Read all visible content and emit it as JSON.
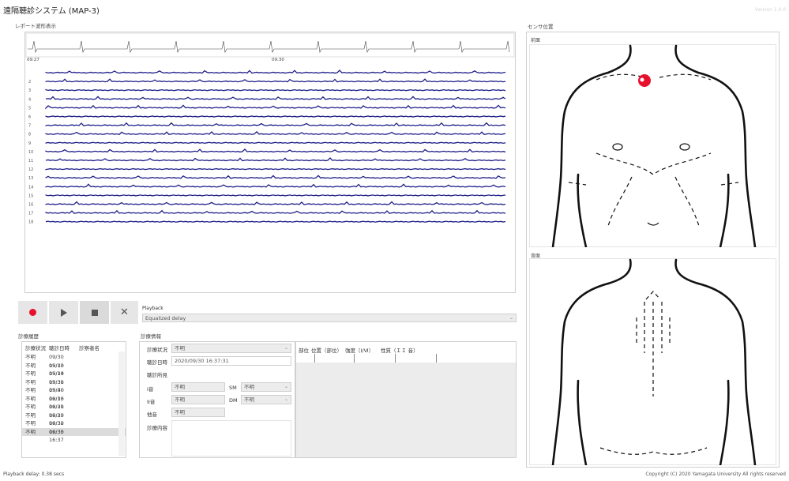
{
  "app": {
    "title": "遠隔聴診システム (MAP-3)",
    "version": "Version 1.0.0"
  },
  "ecg": {
    "section_label": "レポート波形表示",
    "time_left": "09:27",
    "time_mid": "09:30",
    "channel_labels": [
      "",
      "2",
      "3",
      "4",
      "5",
      "6",
      "7",
      "8",
      "9",
      "10",
      "11",
      "12",
      "13",
      "14",
      "15",
      "16",
      "17",
      "18"
    ]
  },
  "colors": {
    "trace": "#1f1f8a",
    "record": "#e8112d",
    "button_bg": "#e6e6e6"
  },
  "controls": {
    "record_icon": "record-icon",
    "play_icon": "play-icon",
    "stop_icon": "stop-icon",
    "close_icon": "close-icon",
    "delay_label": "Playback",
    "delay_select_value": "Equalized delay"
  },
  "history": {
    "section_label": "診療履歴",
    "headers": [
      "診療状況",
      "聴診日時",
      "診察者名"
    ],
    "rows": [
      {
        "status": "不明",
        "datetime": "09/30 15:13",
        "name": ""
      },
      {
        "status": "不明",
        "datetime": "09/30 15:14",
        "name": ""
      },
      {
        "status": "不明",
        "datetime": "09/30 15:31",
        "name": ""
      },
      {
        "status": "不明",
        "datetime": "09/30 15:40",
        "name": ""
      },
      {
        "status": "不明",
        "datetime": "09/30 16:15",
        "name": ""
      },
      {
        "status": "不明",
        "datetime": "09/30 16:21",
        "name": ""
      },
      {
        "status": "不明",
        "datetime": "09/30 16:23",
        "name": ""
      },
      {
        "status": "不明",
        "datetime": "09/30 16:32",
        "name": ""
      },
      {
        "status": "不明",
        "datetime": "09/30 16:35",
        "name": ""
      },
      {
        "status": "不明",
        "datetime": "09/30 16:37",
        "name": ""
      }
    ],
    "selected_index": 9
  },
  "diagnosis": {
    "section_label": "診療情報",
    "status_label": "診療状況",
    "status_value": "不明",
    "datetime_label": "聴診日時",
    "datetime_value": "2020/09/30 16:37:31",
    "findings_label": "聴診所見",
    "rows": [
      {
        "label": "I音",
        "value": "不明",
        "label2": "SM",
        "value2": "不明"
      },
      {
        "label": "II音",
        "value": "不明",
        "label2": "DM",
        "value2": "不明"
      },
      {
        "label": "他音",
        "value": "不明"
      }
    ],
    "notes_label": "診療内容"
  },
  "table_tabs": [
    "部位",
    "位置（部位）",
    "強度（Ⅰ/Ⅵ）",
    "性質（ＩＩ 音）"
  ],
  "sensor": {
    "section_label": "センサ位置",
    "front_label": "前面",
    "back_label": "背面"
  },
  "footer": {
    "left": "Playback delay: 0.38 secs",
    "right": "Copyright (C) 2020 Yamagata University All rights reserved"
  }
}
